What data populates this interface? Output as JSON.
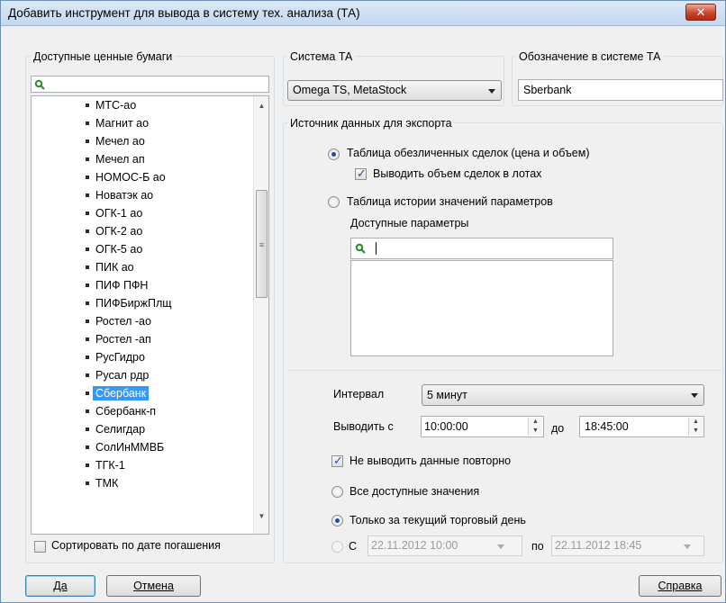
{
  "window": {
    "title": "Добавить инструмент для вывода в систему тех. анализа (ТА)",
    "close_glyph": "✕"
  },
  "securities": {
    "label": "Доступные ценные бумаги",
    "search_value": "",
    "items": [
      "МТС-ао",
      "Магнит ао",
      "Мечел ао",
      "Мечел ап",
      "НОМОС-Б ао",
      "Новатэк ао",
      "ОГК-1 ао",
      "ОГК-2 ао",
      "ОГК-5 ао",
      "ПИК ао",
      "ПИФ ПФН",
      "ПИФБиржПлщ",
      "Ростел -ао",
      "Ростел -ап",
      "РусГидро",
      "Русал рдр",
      "Сбербанк",
      "Сбербанк-п",
      "Селигдар",
      "СолИнММВБ",
      "ТГК-1",
      "ТМК"
    ],
    "selected_index": 16,
    "sort_label": "Сортировать по дате погашения",
    "sort_checked": false
  },
  "ta_system": {
    "label": "Система ТА",
    "value": "Omega TS, MetaStock"
  },
  "designation": {
    "label": "Обозначение в системе ТА",
    "value": "Sberbank"
  },
  "export": {
    "label": "Источник данных для экспорта",
    "option_trades": "Таблица обезличенных сделок (цена и объем)",
    "trades_selected": true,
    "lots_label": "Выводить объем  сделок в лотах",
    "lots_checked": true,
    "option_history": "Таблица истории значений параметров",
    "params_label": "Доступные параметры",
    "params_search_value": ""
  },
  "interval": {
    "label": "Интервал",
    "value": "5 минут"
  },
  "output": {
    "from_label": "Выводить с",
    "from_value": "10:00:00",
    "to_label": "до",
    "to_value": "18:45:00",
    "no_repeat_label": "Не выводить данные повторно",
    "no_repeat_checked": true,
    "all_values_label": "Все доступные значения",
    "today_label": "Только за текущий торговый день",
    "range_from_label": "С",
    "range_from_value": "22.11.2012 10:00",
    "range_to_label": "по",
    "range_to_value": "22.11.2012 18:45"
  },
  "buttons": {
    "ok": "Да",
    "cancel": "Отмена",
    "help": "Справка"
  }
}
